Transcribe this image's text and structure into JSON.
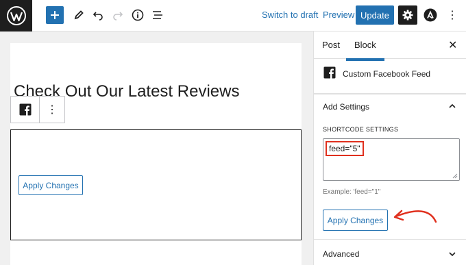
{
  "topbar": {
    "switch_to_draft": "Switch to draft",
    "preview": "Preview",
    "update": "Update"
  },
  "editor": {
    "heading": "Check Out Our Latest Reviews",
    "more_label": "⋮",
    "apply_button": "Apply Changes"
  },
  "sidebar": {
    "tab_post": "Post",
    "tab_block": "Block",
    "close": "✕",
    "block_title": "Custom Facebook Feed",
    "panel_title": "Add Settings",
    "section_label": "SHORTCODE SETTINGS",
    "textarea_value": "feed=\"5\"",
    "example": "Example: 'feed=\"1\"",
    "apply_button": "Apply Changes",
    "advanced": "Advanced"
  },
  "colors": {
    "accent": "#2271b1",
    "dark": "#1e1e1e",
    "highlight": "#e0301e"
  }
}
